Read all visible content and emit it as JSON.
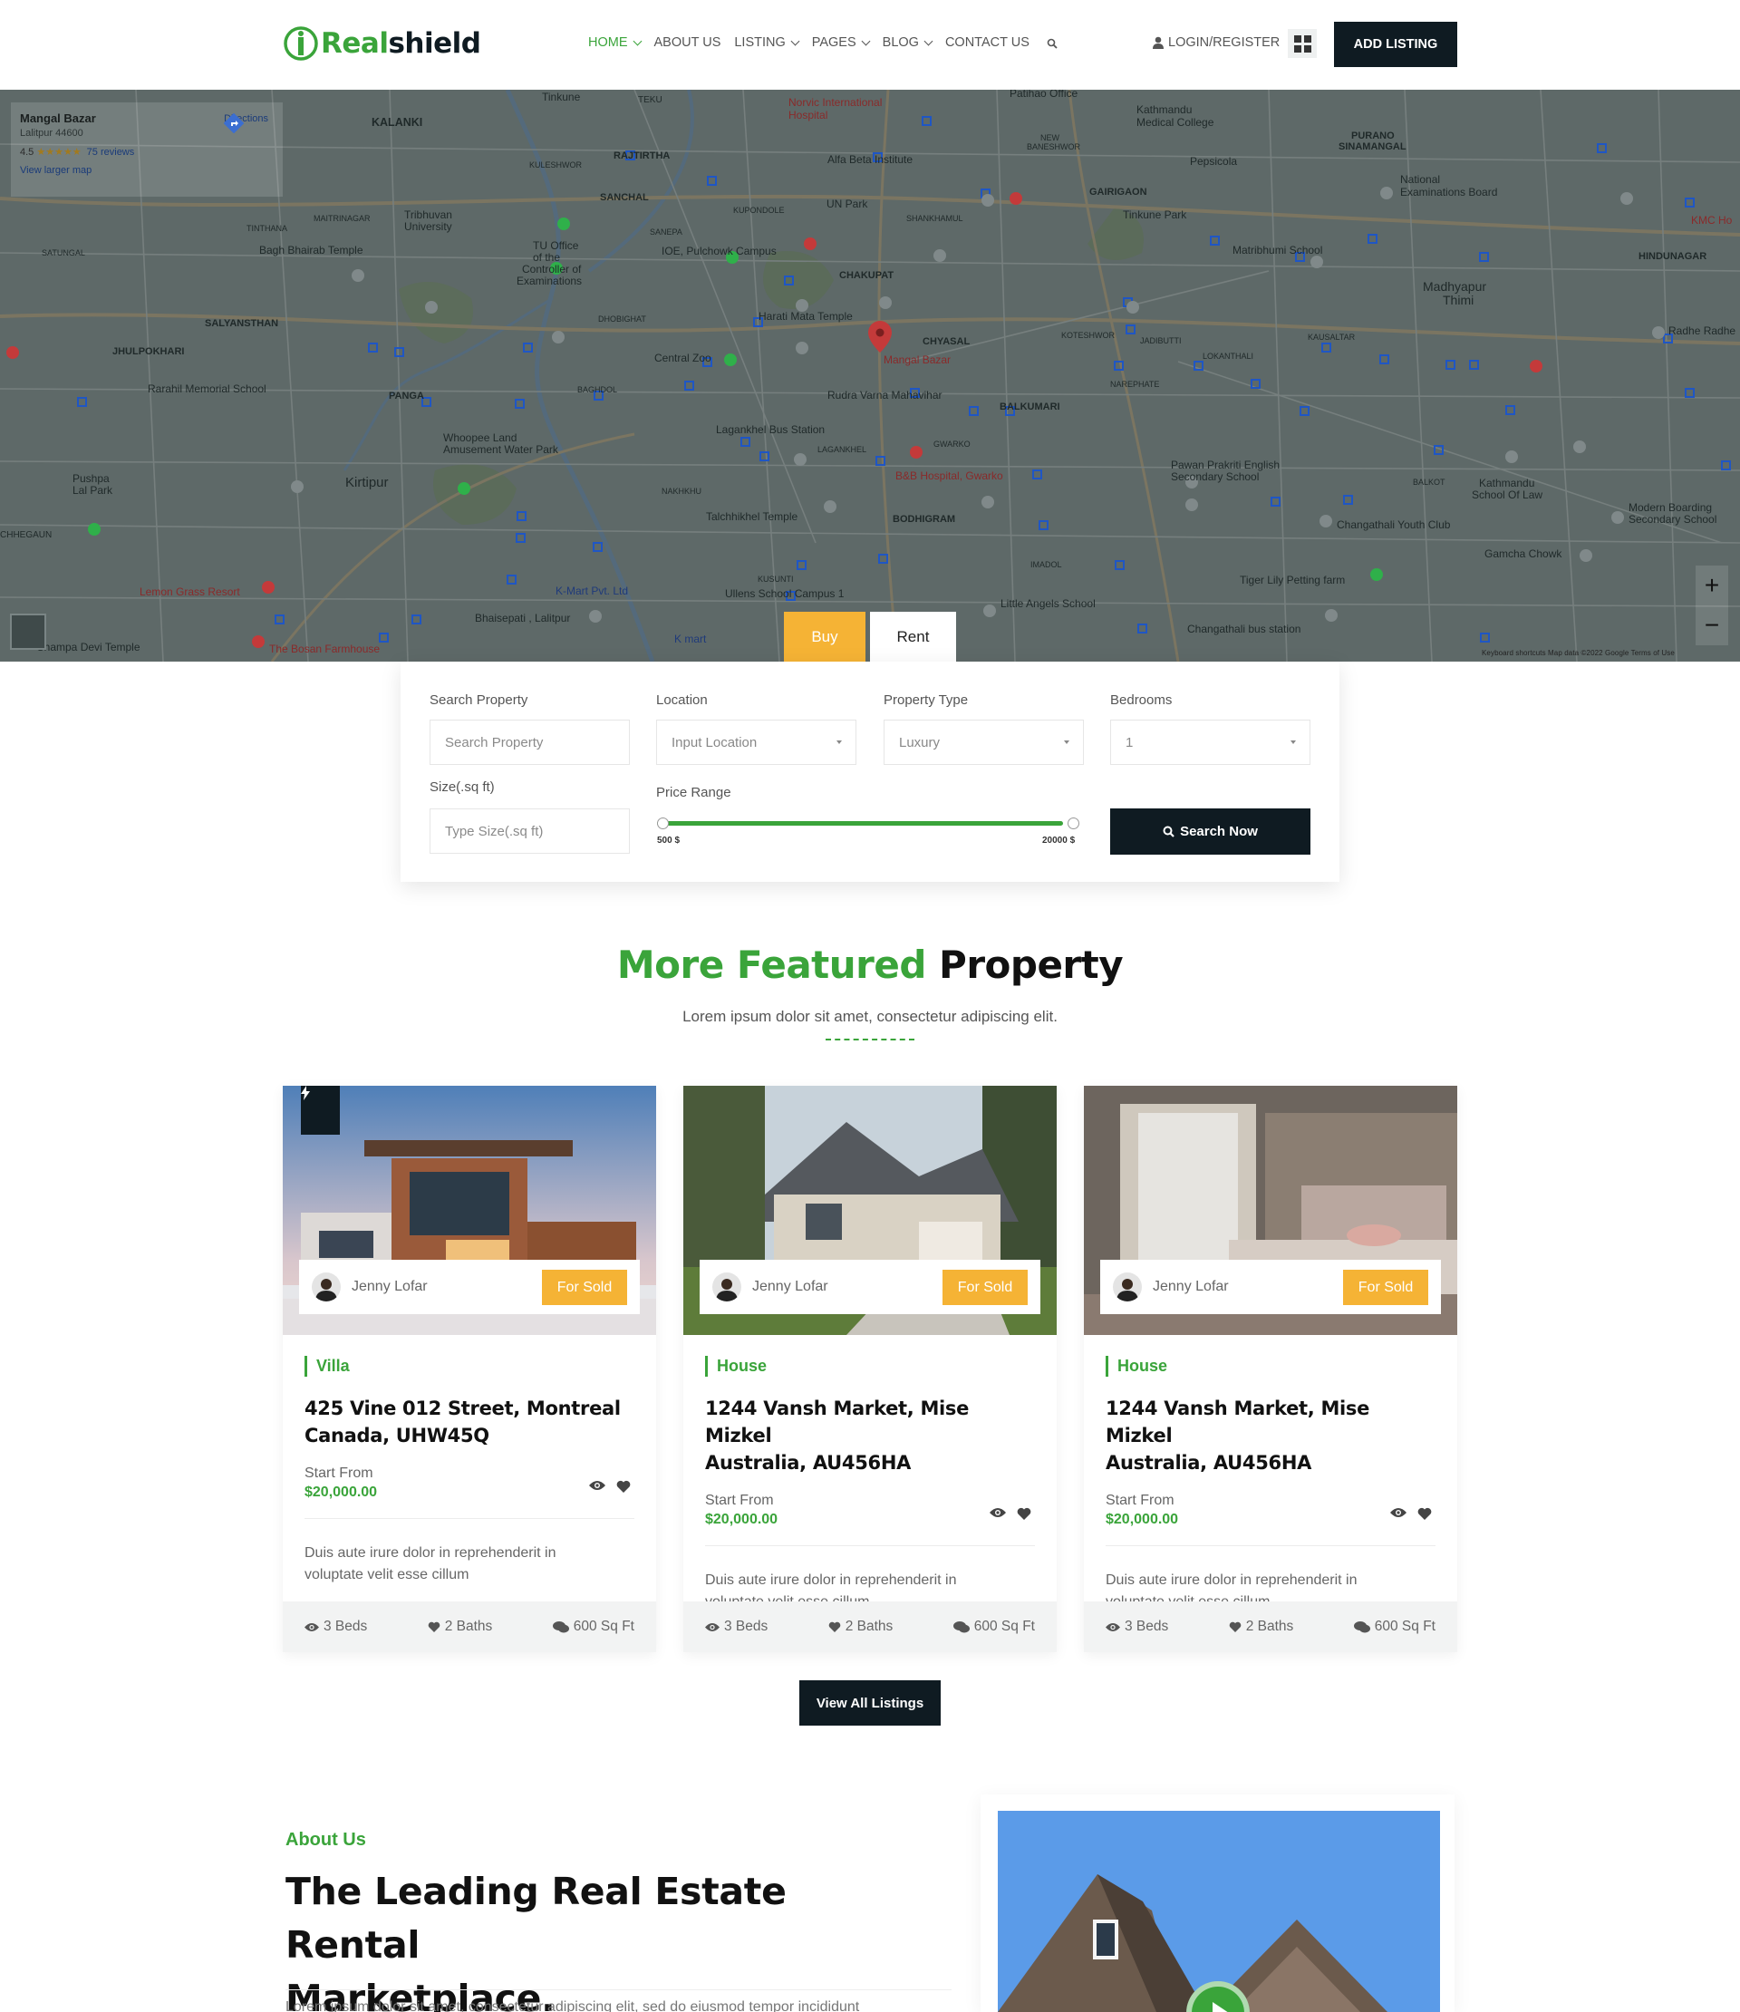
{
  "header": {
    "logo_text_green": "Real",
    "logo_text_dark": "shield",
    "nav": [
      {
        "label": "HOME",
        "dropdown": true,
        "active": true
      },
      {
        "label": "ABOUT US",
        "dropdown": false,
        "active": false
      },
      {
        "label": "LISTING",
        "dropdown": true,
        "active": false
      },
      {
        "label": "PAGES",
        "dropdown": true,
        "active": false
      },
      {
        "label": "BLOG",
        "dropdown": true,
        "active": false
      },
      {
        "label": "CONTACT US",
        "dropdown": false,
        "active": false
      }
    ],
    "login_label": "LOGIN/REGISTER",
    "add_listing_label": "ADD LISTING"
  },
  "map": {
    "place_title": "Mangal Bazar",
    "place_address": "Lalitpur 44600",
    "rating": "4.5",
    "stars": "★★★★★",
    "reviews": "75 reviews",
    "view_larger": "View larger map",
    "directions": "Directions",
    "zoom_in": "+",
    "zoom_out": "−",
    "attribution": "Keyboard shortcuts    Map data ©2022 Google    Terms of Use",
    "labels": [
      "KALANKI",
      "Tinkune",
      "TEKU",
      "Norvic International Hospital",
      "Patihao Office",
      "Kathmandu Medical College",
      "PURANO SINAMANGAL",
      "RAJTIRTHA",
      "KULESHWOR",
      "Alfa Beta Institute",
      "NEW BANESHWOR",
      "Pepsicola",
      "National Examinations Board",
      "SANCHAL",
      "UN Park",
      "GAIRIGAON",
      "MAITRINAGAR",
      "TINTHANA",
      "Tribhuvan University",
      "KUPONDOLE",
      "SHANKHAMUL",
      "Tinkune Park",
      "Bagh Bhairab Temple",
      "SANEPA",
      "IOE, Pulchowk Campus",
      "Matribhumi School",
      "HINDUNAGAR",
      "SATUNGAL",
      "TU Office of the Controller of Examinations",
      "CHAKUPAT",
      "Madhyapur Thimi",
      "DHOBIGHAT",
      "Harati Mata Temple",
      "SALYANSTHAN",
      "KOTESHWOR",
      "JADIBUTTI",
      "KAUSALTAR",
      "JHULPOKHARI",
      "Central Zoo",
      "CHYASAL",
      "Mangal Bazar",
      "LOKANTHALI",
      "Rarahil Memorial School",
      "BAGHDOL",
      "PANGA",
      "Rudra Varna Mahavihar",
      "NAREPHATE",
      "BALKUMARI",
      "Lagankhel Bus Station",
      "Whoopee Land Amusement Water Park",
      "LAGANKHEL",
      "GWARKO",
      "Pawan Prakriti English Secondary School",
      "Kirtipur",
      "Pushpa Lal Park",
      "NAKHKHU",
      "B&B Hospital, Gwarko",
      "BALKOT",
      "Kathmandu School Of Law",
      "Talchhikhel Temple",
      "BODHIGRAM",
      "Changathali Youth Club",
      "Modern Boarding Secondary School",
      "CHHEGAUN",
      "Gamcha Chowk",
      "IMADOL",
      "KUSUNTI",
      "Ullens School Campus 1",
      "Tiger Lily Petting farm",
      "Lemon Grass Resort",
      "K-Mart Pvt. Ltd",
      "Little Angels School",
      "Bhaisepati , Lalitpur",
      "K mart",
      "Changathali bus station",
      "The Bosan Farmhouse",
      "Champa Devi Temple",
      "KMC Hospital",
      "Radhe Radhe"
    ]
  },
  "search": {
    "tabs": [
      "Buy",
      "Rent"
    ],
    "active_tab": "Buy",
    "search_property_label": "Search Property",
    "search_property_placeholder": "Search Property",
    "location_label": "Location",
    "location_value": "Input Location",
    "property_type_label": "Property Type",
    "property_type_value": "Luxury",
    "bedrooms_label": "Bedrooms",
    "bedrooms_value": "1",
    "size_label": "Size(.sq ft)",
    "size_placeholder": "Type Size(.sq ft)",
    "price_range_label": "Price Range",
    "price_min": "500 $",
    "price_max": "20000 $",
    "search_button": "Search Now"
  },
  "featured": {
    "title_green": "More Featured",
    "title_dark": "Property",
    "subtitle": "Lorem ipsum dolor sit amet, consectetur adipiscing elit.",
    "cards": [
      {
        "agent": "Jenny Lofar",
        "status": "For Sold",
        "category": "Villa",
        "address_line1": "425 Vine 012 Street, Montreal",
        "address_line2": "Canada, UHW45Q",
        "start_label": "Start From",
        "price": "$20,000.00",
        "desc_line1": "Duis aute irure dolor in reprehenderit in",
        "desc_line2": "voluptate velit esse cillum",
        "beds": "3 Beds",
        "baths": "2 Baths",
        "size": "600 Sq Ft",
        "featured_badge": true
      },
      {
        "agent": "Jenny Lofar",
        "status": "For Sold",
        "category": "House",
        "address_line1": "1244 Vansh Market, Mise Mizkel",
        "address_line2": "Australia, AU456HA",
        "start_label": "Start From",
        "price": "$20,000.00",
        "desc_line1": "Duis aute irure dolor in reprehenderit in",
        "desc_line2": "voluptate velit esse cillum",
        "beds": "3 Beds",
        "baths": "2 Baths",
        "size": "600 Sq Ft",
        "featured_badge": false
      },
      {
        "agent": "Jenny Lofar",
        "status": "For Sold",
        "category": "House",
        "address_line1": "1244 Vansh Market, Mise Mizkel",
        "address_line2": "Australia, AU456HA",
        "start_label": "Start From",
        "price": "$20,000.00",
        "desc_line1": "Duis aute irure dolor in reprehenderit in",
        "desc_line2": "voluptate velit esse cillum",
        "beds": "3 Beds",
        "baths": "2 Baths",
        "size": "600 Sq Ft",
        "featured_badge": false
      }
    ],
    "view_all": "View All Listings"
  },
  "about": {
    "tag": "About Us",
    "title_line1": "The Leading Real Estate Rental",
    "title_line2": "Marketplace.",
    "text": "Lorem ipsum dolor sit amet, consectetur adipiscing elit, sed do eiusmod tempor incididunt"
  },
  "colors": {
    "brand_green": "#3aa43a",
    "dark": "#0f1b22",
    "accent_yellow": "#f5b335"
  }
}
